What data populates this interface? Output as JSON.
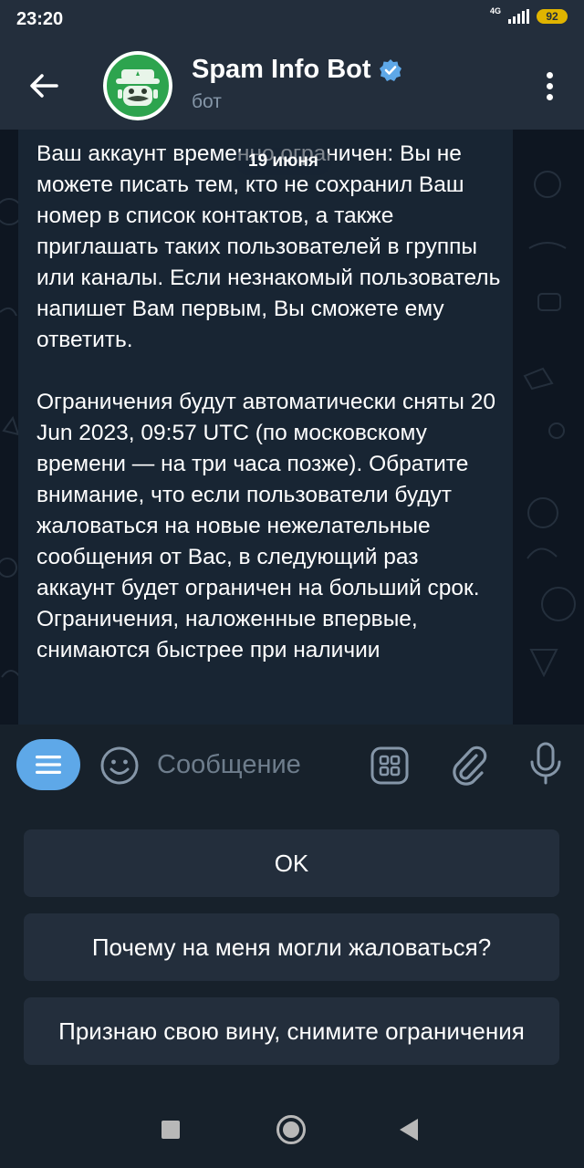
{
  "status_bar": {
    "time": "23:20",
    "network": "4G",
    "battery": "92"
  },
  "header": {
    "title": "Spam Info Bot",
    "subtitle": "бот",
    "verified_icon": "verified-badge-icon"
  },
  "chat": {
    "date_label": "19 июня",
    "message_paragraphs": [
      "Ваш аккаунт временно ограничен: Вы не можете писать тем, кто не сохранил Ваш номер в список контактов, а также приглашать таких пользователей в группы или каналы. Если незнакомый пользователь напишет Вам первым, Вы сможете ему ответить.",
      "Ограничения будут автоматически сняты 20 Jun 2023, 09:57 UTC (по московскому времени — на три часа позже). Обратите внимание, что если пользователи будут жаловаться на новые нежелательные сообщения от Вас, в следующий раз аккаунт будет ограничен на больший срок. Ограничения, наложенные впервые, снимаются быстрее при наличии"
    ]
  },
  "input_bar": {
    "placeholder": "Сообщение"
  },
  "keyboard_buttons": [
    {
      "label": "OK"
    },
    {
      "label": "Почему на меня могли жаловаться?"
    },
    {
      "label": "Признаю свою вину, снимите ограничения"
    }
  ],
  "colors": {
    "accent": "#5ea8e8",
    "header_bg": "#232e3c",
    "chat_bg": "#0e1621",
    "bubble_bg": "#182533",
    "avatar_bg": "#2da44e"
  }
}
